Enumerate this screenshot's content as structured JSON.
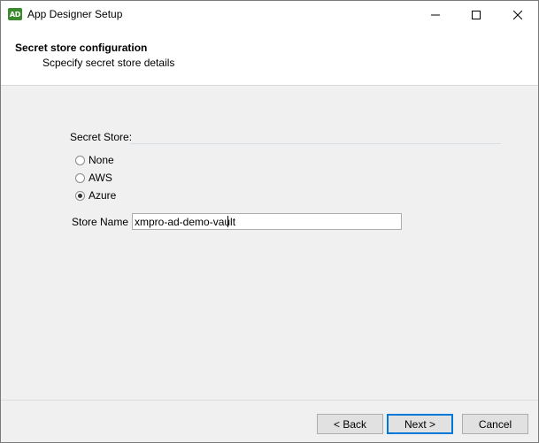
{
  "window": {
    "title": "App Designer Setup",
    "icon_text": "AD"
  },
  "header": {
    "title": "Secret store configuration",
    "subtitle": "Scpecify secret store details"
  },
  "form": {
    "group_label": "Secret Store:",
    "options": [
      {
        "label": "None",
        "checked": false
      },
      {
        "label": "AWS",
        "checked": false
      },
      {
        "label": "Azure",
        "checked": true
      }
    ],
    "store_name_label": "Store Name",
    "store_name_value": "xmpro-ad-demo-vault"
  },
  "buttons": {
    "back": "< Back",
    "next": "Next >",
    "cancel": "Cancel"
  },
  "colors": {
    "accent": "#0078d7",
    "icon_green": "#3c8a2e"
  }
}
